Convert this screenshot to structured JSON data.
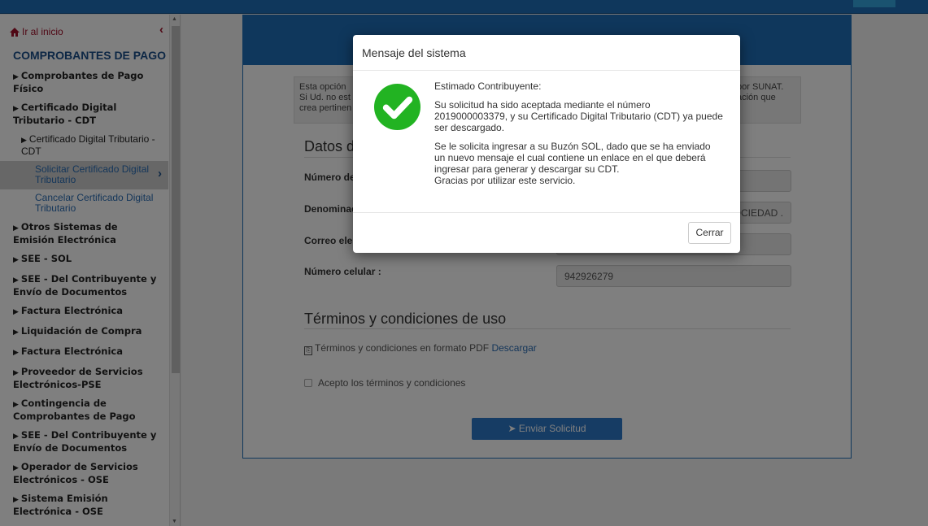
{
  "sidebar": {
    "home_label": "Ir al inicio",
    "section_title": "COMPROBANTES DE PAGO",
    "items": [
      {
        "label": "Comprobantes de Pago Físico"
      },
      {
        "label": "Certificado Digital Tributario - CDT"
      },
      {
        "label": "Certificado Digital Tributario - CDT"
      },
      {
        "label": "Solicitar Certificado Digital Tributario"
      },
      {
        "label": "Cancelar Certificado Digital Tributario"
      },
      {
        "label": "Otros Sistemas de Emisión Electrónica"
      },
      {
        "label": "SEE - SOL"
      },
      {
        "label": "SEE - Del Contribuyente y Envío de Documentos"
      },
      {
        "label": "Factura Electrónica"
      },
      {
        "label": "Liquidación de Compra"
      },
      {
        "label": "Factura Electrónica"
      },
      {
        "label": "Proveedor de Servicios Electrónicos-PSE"
      },
      {
        "label": "Contingencia de Comprobantes de Pago"
      },
      {
        "label": "SEE - Del Contribuyente y Envío de Documentos"
      },
      {
        "label": "Operador de Servicios Electrónicos - OSE"
      },
      {
        "label": "Sistema Emisión Electrónica - OSE"
      }
    ]
  },
  "main": {
    "info_left_1": "Esta opción",
    "info_left_2": "Si Ud. no est",
    "info_left_3": "crea pertinen",
    "info_right_1": "por SUNAT.",
    "info_right_2": "ación que",
    "section_data": "Datos de",
    "label_numero": "Número de",
    "label_denominacion": "Denominac",
    "label_correo": "Correo ele",
    "label_celular": "Número celular :",
    "denominacion_value": "OCIEDAD .",
    "celular_value": "942926279",
    "section_terms": "Términos y condiciones de uso",
    "terms_text": "Términos y condiciones en formato PDF",
    "terms_download": "Descargar",
    "accept_label": "Acepto los términos y condiciones",
    "send_button": "Enviar Solicitud"
  },
  "modal": {
    "title": "Mensaje del sistema",
    "greeting": "Estimado Contribuyente:",
    "para1": "Su solicitud ha sido aceptada mediante el número 2019000003379, y su Certificado Digital Tributario (CDT) ya puede ser descargado.",
    "para2": "Se le solicita ingresar a su Buzón SOL, dado que se ha enviado un nuevo mensaje el cual contiene un enlace en el que deberá ingresar para generar y descargar su CDT.",
    "para3": "Gracias por utilizar este servicio.",
    "close_button": "Cerrar"
  },
  "colors": {
    "brand_blue": "#1f6fb8",
    "success_green": "#22b322",
    "accent_red": "#a0102a"
  }
}
